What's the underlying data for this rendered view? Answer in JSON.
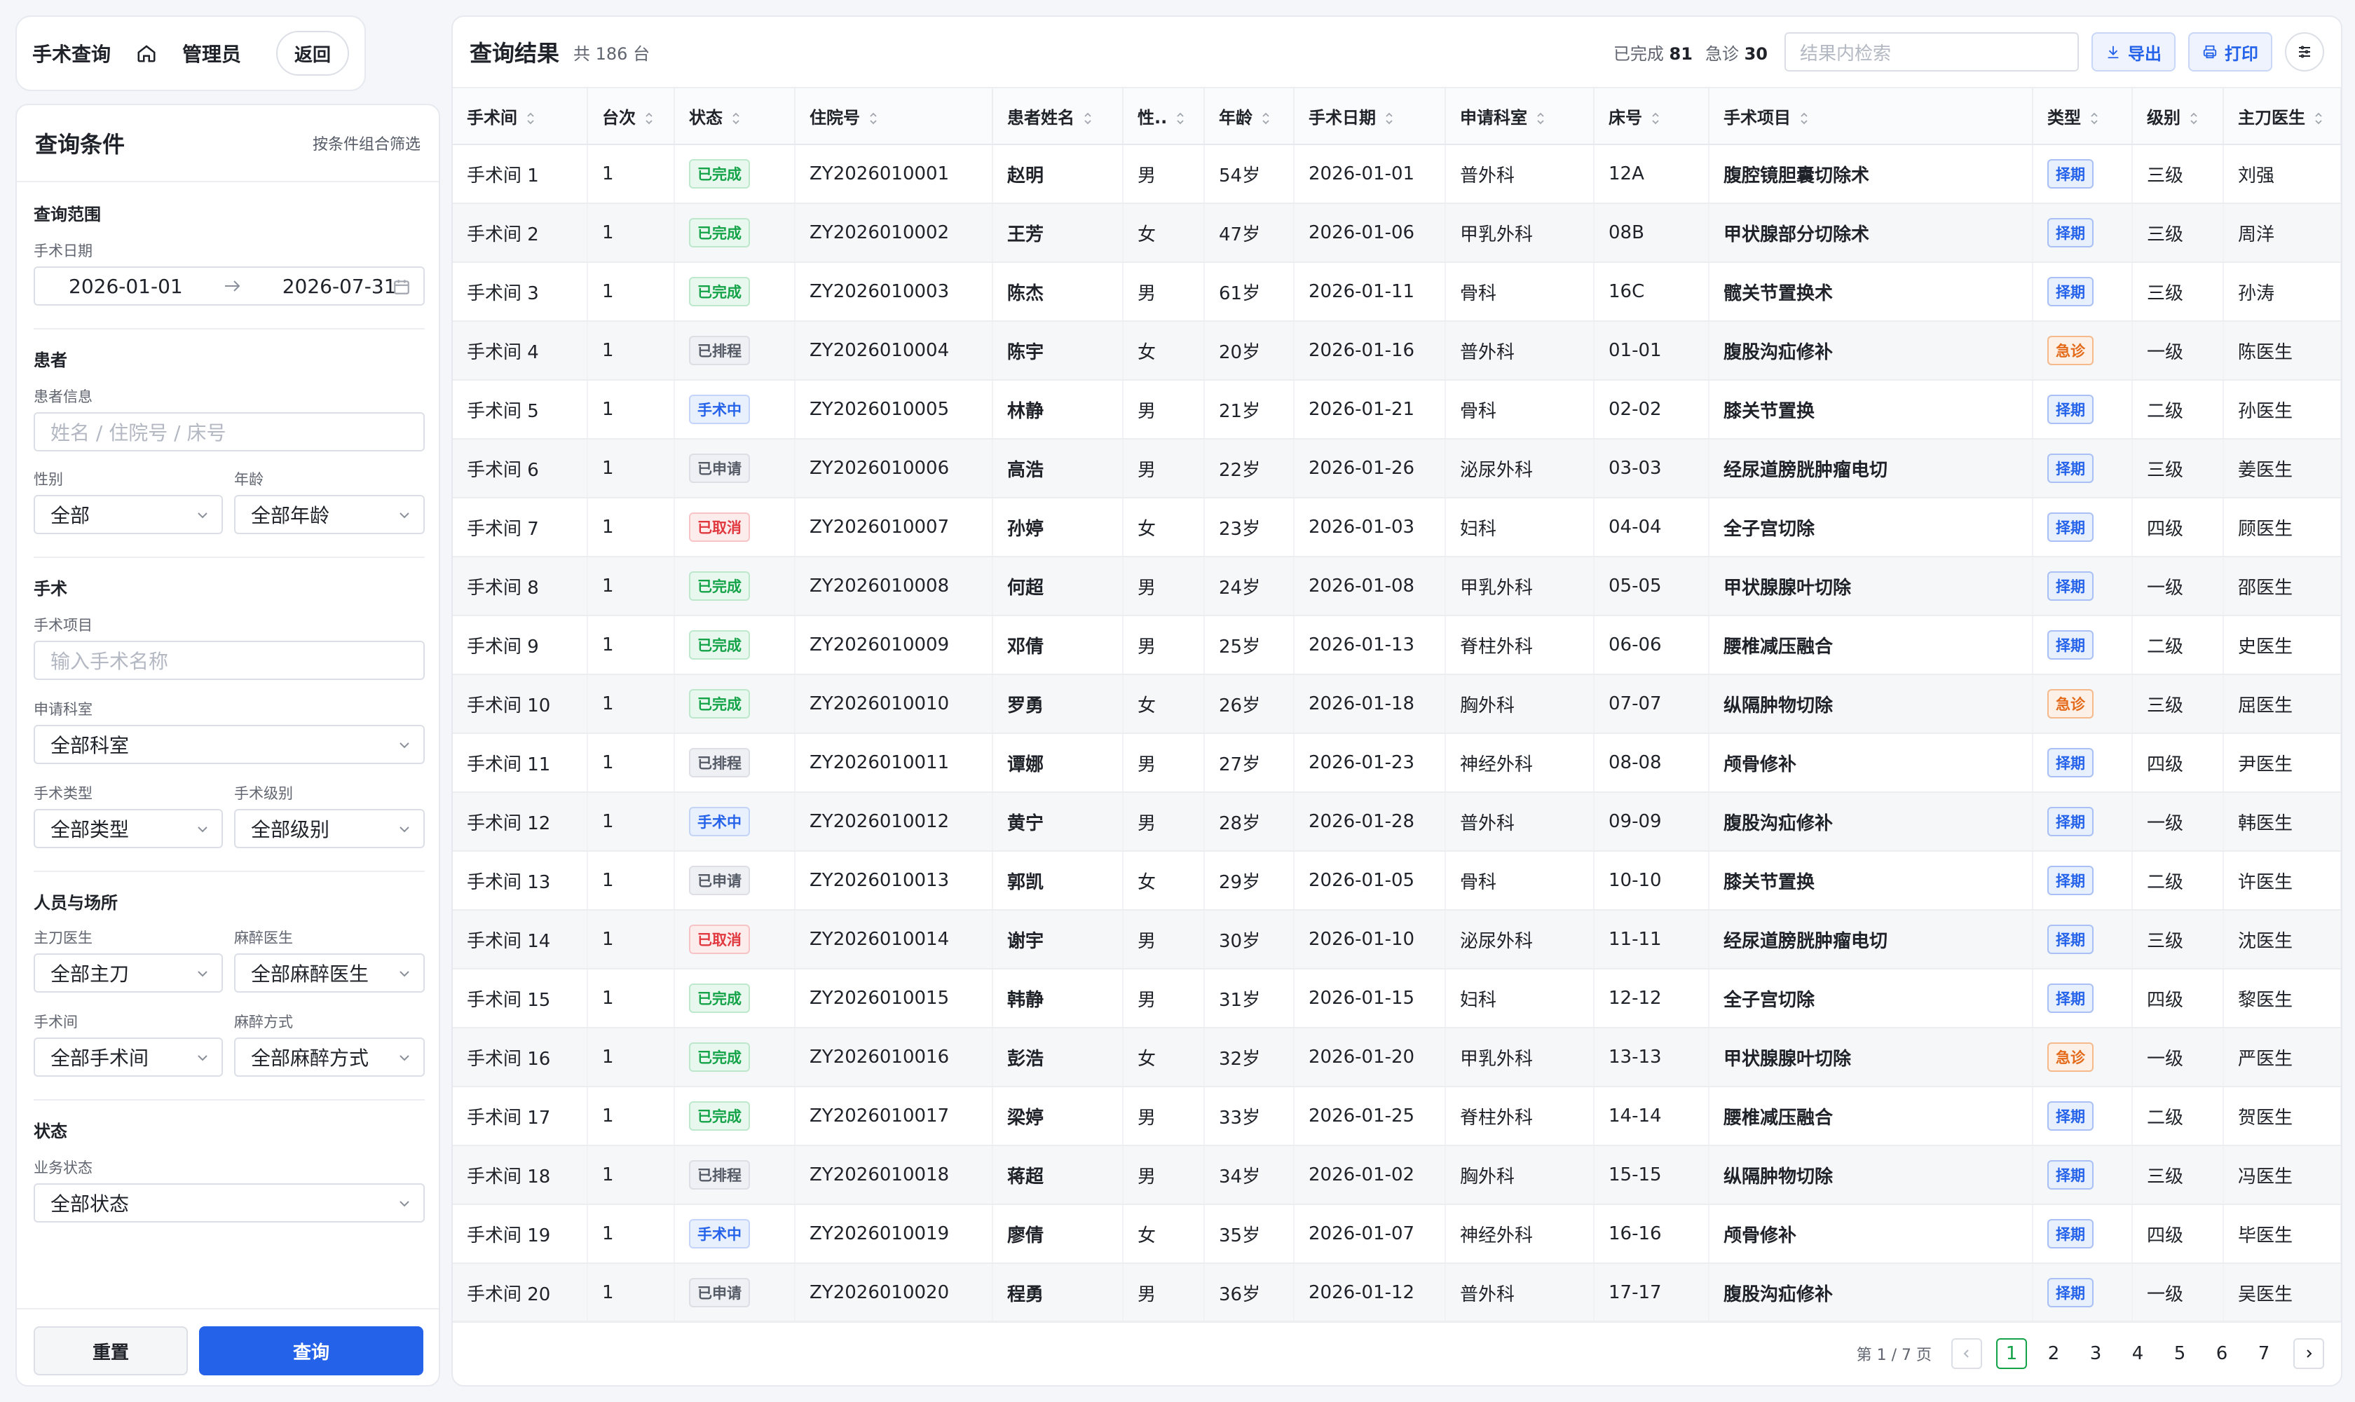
{
  "header": {
    "title": "手术查询",
    "role": "管理员",
    "back": "返回"
  },
  "filters": {
    "title": "查询条件",
    "hint": "按条件组合筛选",
    "range": {
      "section": "查询范围",
      "date_label": "手术日期",
      "date_from": "2026-01-01",
      "date_to": "2026-07-31"
    },
    "patient": {
      "section": "患者",
      "info_label": "患者信息",
      "info_placeholder": "姓名 / 住院号 / 床号",
      "sex_label": "性别",
      "sex_value": "全部",
      "age_label": "年龄",
      "age_value": "全部年龄"
    },
    "surgery": {
      "section": "手术",
      "item_label": "手术项目",
      "item_placeholder": "输入手术名称",
      "dept_label": "申请科室",
      "dept_value": "全部科室",
      "type_label": "手术类型",
      "type_value": "全部类型",
      "level_label": "手术级别",
      "level_value": "全部级别"
    },
    "staff": {
      "section": "人员与场所",
      "surgeon_label": "主刀医生",
      "surgeon_value": "全部主刀",
      "anes_doc_label": "麻醉医生",
      "anes_doc_value": "全部麻醉医生",
      "room_label": "手术间",
      "room_value": "全部手术间",
      "anes_way_label": "麻醉方式",
      "anes_way_value": "全部麻醉方式"
    },
    "status": {
      "section": "状态",
      "biz_label": "业务状态",
      "biz_value": "全部状态"
    },
    "reset": "重置",
    "query": "查询"
  },
  "results": {
    "title": "查询结果",
    "count": "共 186 台",
    "done_label": "已完成",
    "done_value": "81",
    "emerg_label": "急诊",
    "emerg_value": "30",
    "search_placeholder": "结果内检索",
    "export": "导出",
    "print": "打印",
    "columns": [
      "手术间",
      "台次",
      "状态",
      "住院号",
      "患者姓名",
      "性..",
      "年龄",
      "手术日期",
      "申请科室",
      "床号",
      "手术项目",
      "类型",
      "级别",
      "主刀医生"
    ],
    "rows": [
      [
        "手术间 1",
        "1",
        "已完成",
        "ZY2026010001",
        "赵明",
        "男",
        "54岁",
        "2026-01-01",
        "普外科",
        "12A",
        "腹腔镜胆囊切除术",
        "择期",
        "三级",
        "刘强"
      ],
      [
        "手术间 2",
        "1",
        "已完成",
        "ZY2026010002",
        "王芳",
        "女",
        "47岁",
        "2026-01-06",
        "甲乳外科",
        "08B",
        "甲状腺部分切除术",
        "择期",
        "三级",
        "周洋"
      ],
      [
        "手术间 3",
        "1",
        "已完成",
        "ZY2026010003",
        "陈杰",
        "男",
        "61岁",
        "2026-01-11",
        "骨科",
        "16C",
        "髋关节置换术",
        "择期",
        "三级",
        "孙涛"
      ],
      [
        "手术间 4",
        "1",
        "已排程",
        "ZY2026010004",
        "陈宇",
        "女",
        "20岁",
        "2026-01-16",
        "普外科",
        "01-01",
        "腹股沟疝修补",
        "急诊",
        "一级",
        "陈医生"
      ],
      [
        "手术间 5",
        "1",
        "手术中",
        "ZY2026010005",
        "林静",
        "男",
        "21岁",
        "2026-01-21",
        "骨科",
        "02-02",
        "膝关节置换",
        "择期",
        "二级",
        "孙医生"
      ],
      [
        "手术间 6",
        "1",
        "已申请",
        "ZY2026010006",
        "高浩",
        "男",
        "22岁",
        "2026-01-26",
        "泌尿外科",
        "03-03",
        "经尿道膀胱肿瘤电切",
        "择期",
        "三级",
        "姜医生"
      ],
      [
        "手术间 7",
        "1",
        "已取消",
        "ZY2026010007",
        "孙婷",
        "女",
        "23岁",
        "2026-01-03",
        "妇科",
        "04-04",
        "全子宫切除",
        "择期",
        "四级",
        "顾医生"
      ],
      [
        "手术间 8",
        "1",
        "已完成",
        "ZY2026010008",
        "何超",
        "男",
        "24岁",
        "2026-01-08",
        "甲乳外科",
        "05-05",
        "甲状腺腺叶切除",
        "择期",
        "一级",
        "邵医生"
      ],
      [
        "手术间 9",
        "1",
        "已完成",
        "ZY2026010009",
        "邓倩",
        "男",
        "25岁",
        "2026-01-13",
        "脊柱外科",
        "06-06",
        "腰椎减压融合",
        "择期",
        "二级",
        "史医生"
      ],
      [
        "手术间 10",
        "1",
        "已完成",
        "ZY2026010010",
        "罗勇",
        "女",
        "26岁",
        "2026-01-18",
        "胸外科",
        "07-07",
        "纵隔肿物切除",
        "急诊",
        "三级",
        "屈医生"
      ],
      [
        "手术间 11",
        "1",
        "已排程",
        "ZY2026010011",
        "谭娜",
        "男",
        "27岁",
        "2026-01-23",
        "神经外科",
        "08-08",
        "颅骨修补",
        "择期",
        "四级",
        "尹医生"
      ],
      [
        "手术间 12",
        "1",
        "手术中",
        "ZY2026010012",
        "黄宁",
        "男",
        "28岁",
        "2026-01-28",
        "普外科",
        "09-09",
        "腹股沟疝修补",
        "择期",
        "一级",
        "韩医生"
      ],
      [
        "手术间 13",
        "1",
        "已申请",
        "ZY2026010013",
        "郭凯",
        "女",
        "29岁",
        "2026-01-05",
        "骨科",
        "10-10",
        "膝关节置换",
        "择期",
        "二级",
        "许医生"
      ],
      [
        "手术间 14",
        "1",
        "已取消",
        "ZY2026010014",
        "谢宇",
        "男",
        "30岁",
        "2026-01-10",
        "泌尿外科",
        "11-11",
        "经尿道膀胱肿瘤电切",
        "择期",
        "三级",
        "沈医生"
      ],
      [
        "手术间 15",
        "1",
        "已完成",
        "ZY2026010015",
        "韩静",
        "男",
        "31岁",
        "2026-01-15",
        "妇科",
        "12-12",
        "全子宫切除",
        "择期",
        "四级",
        "黎医生"
      ],
      [
        "手术间 16",
        "1",
        "已完成",
        "ZY2026010016",
        "彭浩",
        "女",
        "32岁",
        "2026-01-20",
        "甲乳外科",
        "13-13",
        "甲状腺腺叶切除",
        "急诊",
        "一级",
        "严医生"
      ],
      [
        "手术间 17",
        "1",
        "已完成",
        "ZY2026010017",
        "梁婷",
        "男",
        "33岁",
        "2026-01-25",
        "脊柱外科",
        "14-14",
        "腰椎减压融合",
        "择期",
        "二级",
        "贺医生"
      ],
      [
        "手术间 18",
        "1",
        "已排程",
        "ZY2026010018",
        "蒋超",
        "男",
        "34岁",
        "2026-01-02",
        "胸外科",
        "15-15",
        "纵隔肿物切除",
        "择期",
        "三级",
        "冯医生"
      ],
      [
        "手术间 19",
        "1",
        "手术中",
        "ZY2026010019",
        "廖倩",
        "女",
        "35岁",
        "2026-01-07",
        "神经外科",
        "16-16",
        "颅骨修补",
        "择期",
        "四级",
        "毕医生"
      ],
      [
        "手术间 20",
        "1",
        "已申请",
        "ZY2026010020",
        "程勇",
        "男",
        "36岁",
        "2026-01-12",
        "普外科",
        "17-17",
        "腹股沟疝修补",
        "择期",
        "一级",
        "吴医生"
      ]
    ],
    "pager": {
      "info": "第 1 / 7 页",
      "pages": [
        "1",
        "2",
        "3",
        "4",
        "5",
        "6",
        "7"
      ],
      "current": "1"
    }
  }
}
